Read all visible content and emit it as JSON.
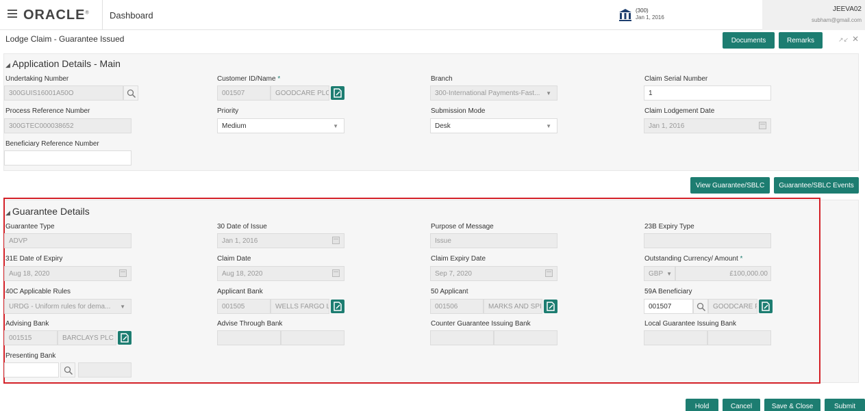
{
  "header": {
    "logo": "ORACLE",
    "logo_mark": "®",
    "title": "Dashboard",
    "branch_code": "(300)",
    "branch_date": "Jan 1, 2016",
    "user_id": "JEEVA02",
    "user_email": "subham@gmail.com"
  },
  "subheader": {
    "title": "Lodge Claim - Guarantee Issued",
    "documents_label": "Documents",
    "remarks_label": "Remarks"
  },
  "app_details": {
    "title": "Application Details - Main",
    "undertaking_number": {
      "label": "Undertaking Number",
      "value": "300GUIS16001A50O"
    },
    "customer": {
      "label": "Customer ID/Name",
      "required": "*",
      "id": "001507",
      "name": "GOODCARE PLC"
    },
    "branch": {
      "label": "Branch",
      "value": "300-International Payments-Fast..."
    },
    "claim_serial": {
      "label": "Claim Serial Number",
      "value": "1"
    },
    "process_ref": {
      "label": "Process Reference Number",
      "value": "300GTEC000038652"
    },
    "priority": {
      "label": "Priority",
      "value": "Medium"
    },
    "submission_mode": {
      "label": "Submission Mode",
      "value": "Desk"
    },
    "claim_lodgement_date": {
      "label": "Claim Lodgement Date",
      "value": "Jan 1, 2016"
    },
    "beneficiary_ref": {
      "label": "Beneficiary Reference Number",
      "value": ""
    }
  },
  "action_buttons": {
    "view_guarantee": "View Guarantee/SBLC",
    "guarantee_events": "Guarantee/SBLC Events"
  },
  "guarantee_details": {
    "title": "Guarantee Details",
    "guarantee_type": {
      "label": "Guarantee Type",
      "value": "ADVP"
    },
    "date_of_issue": {
      "label": "30 Date of Issue",
      "value": "Jan 1, 2016"
    },
    "purpose": {
      "label": "Purpose of Message",
      "value": "Issue"
    },
    "expiry_type": {
      "label": "23B Expiry Type",
      "value": ""
    },
    "date_of_expiry": {
      "label": "31E Date of Expiry",
      "value": "Aug 18, 2020"
    },
    "claim_date": {
      "label": "Claim Date",
      "value": "Aug 18, 2020"
    },
    "claim_expiry_date": {
      "label": "Claim Expiry Date",
      "value": "Sep 7, 2020"
    },
    "outstanding": {
      "label": "Outstanding Currency/ Amount",
      "required": "*",
      "currency": "GBP",
      "amount": "£100,000.00"
    },
    "applicable_rules": {
      "label": "40C Applicable Rules",
      "value": "URDG - Uniform rules for dema..."
    },
    "applicant_bank": {
      "label": "Applicant Bank",
      "id": "001505",
      "name": "WELLS FARGO L"
    },
    "applicant": {
      "label": "50 Applicant",
      "id": "001506",
      "name": "MARKS AND SPI"
    },
    "beneficiary": {
      "label": "59A Beneficiary",
      "id": "001507",
      "name": "GOODCARE P"
    },
    "advising_bank": {
      "label": "Advising Bank",
      "id": "001515",
      "name": "BARCLAYS PLC"
    },
    "advise_through_bank": {
      "label": "Advise Through Bank"
    },
    "counter_guarantee_bank": {
      "label": "Counter Guarantee Issuing Bank"
    },
    "local_guarantee_bank": {
      "label": "Local Guarantee Issuing Bank"
    },
    "presenting_bank": {
      "label": "Presenting Bank"
    }
  },
  "footer": {
    "hold": "Hold",
    "cancel": "Cancel",
    "save_close": "Save & Close",
    "submit": "Submit"
  },
  "colors": {
    "accent": "#1d7d71",
    "highlight": "#d32027"
  }
}
